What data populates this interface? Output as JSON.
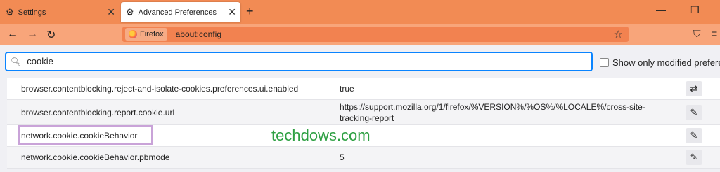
{
  "tabs": [
    {
      "title": "Settings",
      "icon": "gear-icon",
      "active": false
    },
    {
      "title": "Advanced Preferences",
      "icon": "gear-icon",
      "active": true
    }
  ],
  "toolbar": {
    "identity_label": "Firefox",
    "url": "about:config"
  },
  "search": {
    "value": "cookie",
    "modified_label": "Show only modified preferences"
  },
  "prefs": [
    {
      "name": "browser.contentblocking.reject-and-isolate-cookies.preferences.ui.enabled",
      "value": "true",
      "action": "toggle"
    },
    {
      "name": "browser.contentblocking.report.cookie.url",
      "value": "https://support.mozilla.org/1/firefox/%VERSION%/%OS%/%LOCALE%/cross-site-tracking-report",
      "action": "edit"
    },
    {
      "name": "network.cookie.cookieBehavior",
      "value": "",
      "action": "edit",
      "highlighted": true
    },
    {
      "name": "network.cookie.cookieBehavior.pbmode",
      "value": "5",
      "action": "edit"
    }
  ],
  "watermark": "techdows.com",
  "colors": {
    "tabbar": "#f28b54",
    "navbar": "#f8a57a",
    "accent": "#0a84ff",
    "highlight": "#c9a3d8",
    "watermark": "#2ea043"
  }
}
